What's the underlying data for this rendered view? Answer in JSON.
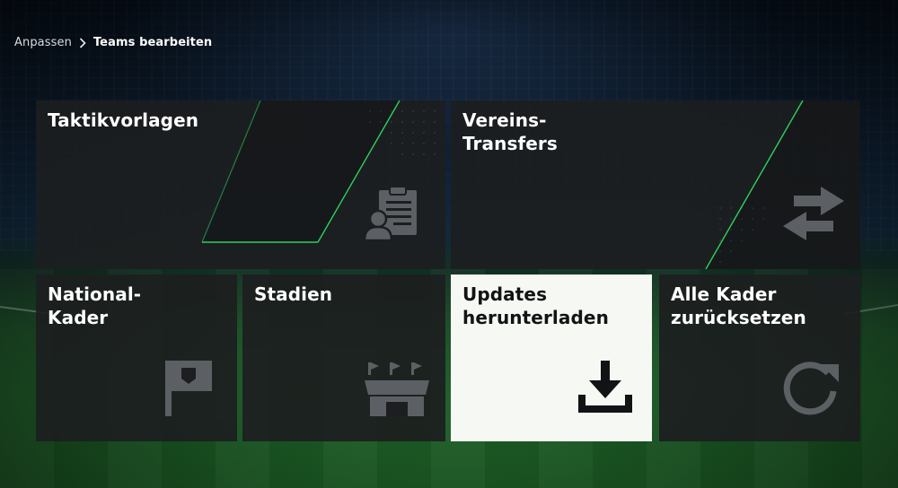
{
  "breadcrumb": {
    "parent": "Anpassen",
    "current": "Teams bearbeiten"
  },
  "tiles": [
    {
      "id": "taktikvorlagen",
      "title": "Taktikvorlagen",
      "icon": "clipboard-user-icon",
      "selected": false
    },
    {
      "id": "vereins-transfers",
      "title": "Vereins-\nTransfers",
      "icon": "transfer-arrows-icon",
      "selected": false
    },
    {
      "id": "national-kader",
      "title": "National-\nKader",
      "icon": "flag-icon",
      "selected": false
    },
    {
      "id": "stadien",
      "title": "Stadien",
      "icon": "stadium-icon",
      "selected": false
    },
    {
      "id": "updates-herunterladen",
      "title": "Updates\nherunterladen",
      "icon": "download-icon",
      "selected": true
    },
    {
      "id": "alle-kader-zuruecksetzen",
      "title": "Alle Kader\nzurücksetzen",
      "icon": "reset-icon",
      "selected": false
    }
  ],
  "colors": {
    "accent_green": "#2fd15c",
    "tile_bg": "#1c1e20",
    "tile_selected_bg": "#f6f8f3",
    "icon_gray": "#5c6064"
  }
}
